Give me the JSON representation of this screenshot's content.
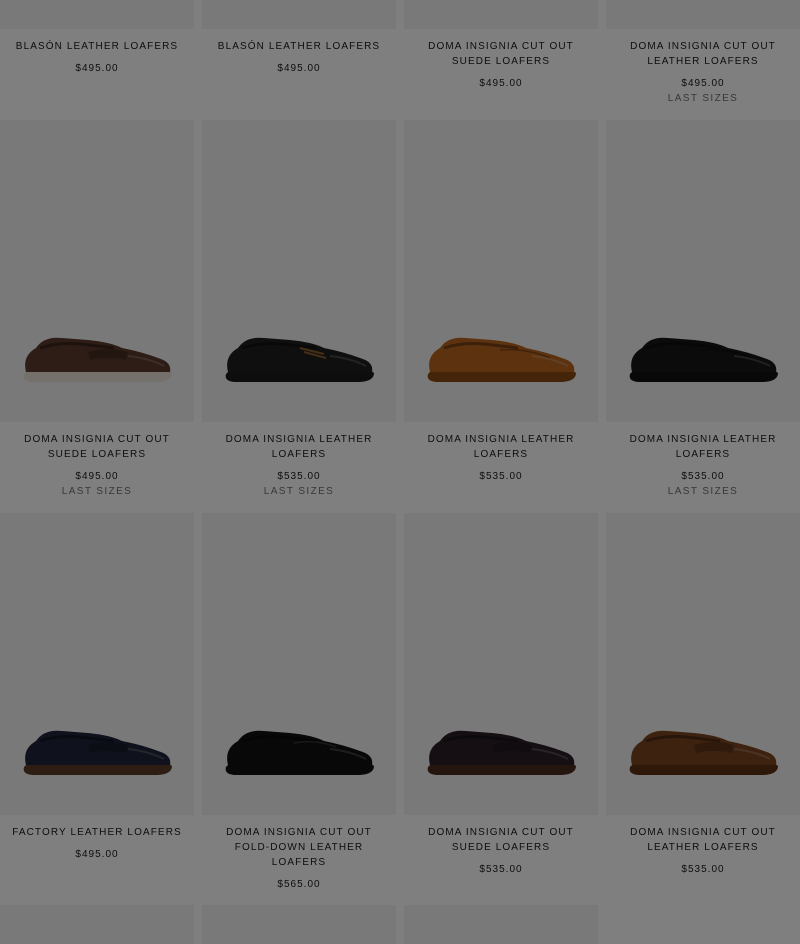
{
  "products": [
    {
      "name": "BLASÓN LEATHER LOAFERS",
      "price": "$495.00",
      "badge": ""
    },
    {
      "name": "BLASÓN LEATHER LOAFERS",
      "price": "$495.00",
      "badge": ""
    },
    {
      "name": "DOMA INSIGNIA CUT OUT SUEDE LOAFERS",
      "price": "$495.00",
      "badge": ""
    },
    {
      "name": "DOMA INSIGNIA CUT OUT LEATHER LOAFERS",
      "price": "$495.00",
      "badge": "LAST SIZES"
    },
    {
      "name": "DOMA INSIGNIA CUT OUT SUEDE LOAFERS",
      "price": "$495.00",
      "badge": "LAST SIZES",
      "color": "#5a3a2c",
      "sole": "#e8e3da",
      "style": "penny"
    },
    {
      "name": "DOMA INSIGNIA LEATHER LOAFERS",
      "price": "$535.00",
      "badge": "LAST SIZES",
      "color": "#1e1e1e",
      "sole": "#1a1a1a",
      "style": "boat"
    },
    {
      "name": "DOMA INSIGNIA LEATHER LOAFERS",
      "price": "$535.00",
      "badge": "",
      "color": "#b8651f",
      "sole": "#8a4a15",
      "style": "driver"
    },
    {
      "name": "DOMA INSIGNIA LEATHER LOAFERS",
      "price": "$535.00",
      "badge": "LAST SIZES",
      "color": "#161616",
      "sole": "#111111",
      "style": "driver"
    },
    {
      "name": "FACTORY LEATHER LOAFERS",
      "price": "$495.00",
      "badge": "",
      "color": "#1f2438",
      "sole": "#5a3a26",
      "style": "penny"
    },
    {
      "name": "DOMA INSIGNIA CUT OUT FOLD-DOWN LEATHER LOAFERS",
      "price": "$565.00",
      "badge": "",
      "color": "#111111",
      "sole": "#111111",
      "style": "slipper"
    },
    {
      "name": "DOMA INSIGNIA CUT OUT SUEDE LOAFERS",
      "price": "$535.00",
      "badge": "",
      "color": "#2a1f29",
      "sole": "#4a2a1e",
      "style": "penny"
    },
    {
      "name": "DOMA INSIGNIA CUT OUT LEATHER LOAFERS",
      "price": "$535.00",
      "badge": "",
      "color": "#7b4520",
      "sole": "#5a3015",
      "style": "penny"
    }
  ]
}
